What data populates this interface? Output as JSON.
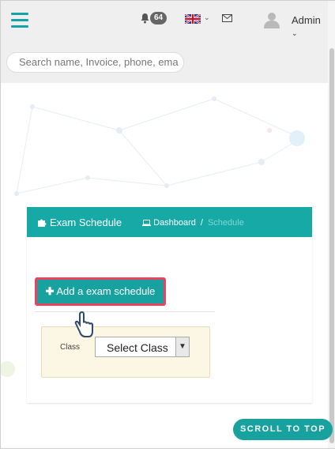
{
  "header": {
    "notification_count": "64",
    "user_name": "Admin",
    "search_placeholder": "Search name, Invoice, phone, ema"
  },
  "card": {
    "title": "Exam Schedule",
    "breadcrumb": {
      "home": "Dashboard",
      "separator": "/",
      "current": "Schedule"
    },
    "add_button_label": "Add a exam schedule",
    "filter": {
      "label": "Class",
      "select_value": "Select Class"
    }
  },
  "scroll_top_label": "SCROLL TO TOP",
  "colors": {
    "accent": "#17a2a0",
    "highlight_border": "#e8435f",
    "filter_bg": "#fcf7e4"
  },
  "icons": [
    "hamburger-icon",
    "bell-icon",
    "uk-flag-icon",
    "mail-icon",
    "user-avatar-icon",
    "puzzle-icon",
    "laptop-icon",
    "plus-icon",
    "pointer-hand-icon"
  ]
}
